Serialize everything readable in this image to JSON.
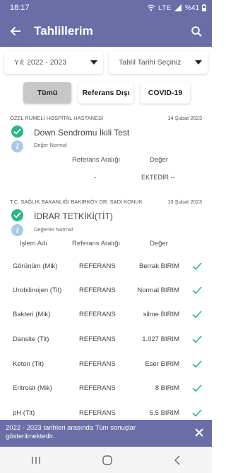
{
  "status_bar": {
    "time": "18:17",
    "battery": "%41",
    "indicators": "LTE"
  },
  "app_bar": {
    "title": "Tahlillerim"
  },
  "filters": {
    "year": "Yıl: 2022 - 2023",
    "date_placeholder": "Tahlil Tarihi Seçiniz"
  },
  "tabs": [
    {
      "label": "Tümü"
    },
    {
      "label": "Referans Dışı"
    },
    {
      "label": "COVID-19"
    }
  ],
  "results": [
    {
      "hospital": "ÖZEL RUMELİ HOSPİTAL HASTANESİ",
      "date": "14 Şubat 2023",
      "title": "Down Sendromu  İkili Test",
      "status": "Değer Normal",
      "headers": {
        "reference": "Referans Aralığı",
        "value": "Değer"
      },
      "row": {
        "reference": "-",
        "value": "EKTEDİR --"
      }
    },
    {
      "hospital": "T.C. SAĞLIK BAKANLIĞI BAKIRKÖY DR. SADİ KONUK",
      "date": "10 Şubat 2023",
      "title": "İDRAR TETKİKİ(TİT)",
      "status": "Değerler Normal",
      "headers": {
        "name": "İşlem Adı",
        "reference": "Referans Aralığı",
        "value": "Değer"
      },
      "rows": [
        {
          "name": "Görünüm (Mik)",
          "reference": "REFERANS",
          "value": "Berrak BIRIM"
        },
        {
          "name": "Urobilinojen (Tit)",
          "reference": "REFERANS",
          "value": "Normal BIRIM"
        },
        {
          "name": "Bakteri (Mik)",
          "reference": "REFERANS",
          "value": "silme BIRIM"
        },
        {
          "name": "Dansite (Tit)",
          "reference": "REFERANS",
          "value": "1.027 BIRIM"
        },
        {
          "name": "Keton (Tit)",
          "reference": "REFERANS",
          "value": "Eser BIRIM"
        },
        {
          "name": "Eritrosit (Mik)",
          "reference": "REFERANS",
          "value": "8 BIRIM"
        },
        {
          "name": "pH (Tit)",
          "reference": "REFERANS",
          "value": "6.5 BIRIM"
        }
      ]
    }
  ],
  "snackbar": {
    "message": "2022 - 2023 tarihleri arasında Tüm sonuçlar gösterilmektedir."
  },
  "colors": {
    "primary": "#6b6ea6",
    "success": "#2fb387",
    "info": "#a8c9e8"
  }
}
